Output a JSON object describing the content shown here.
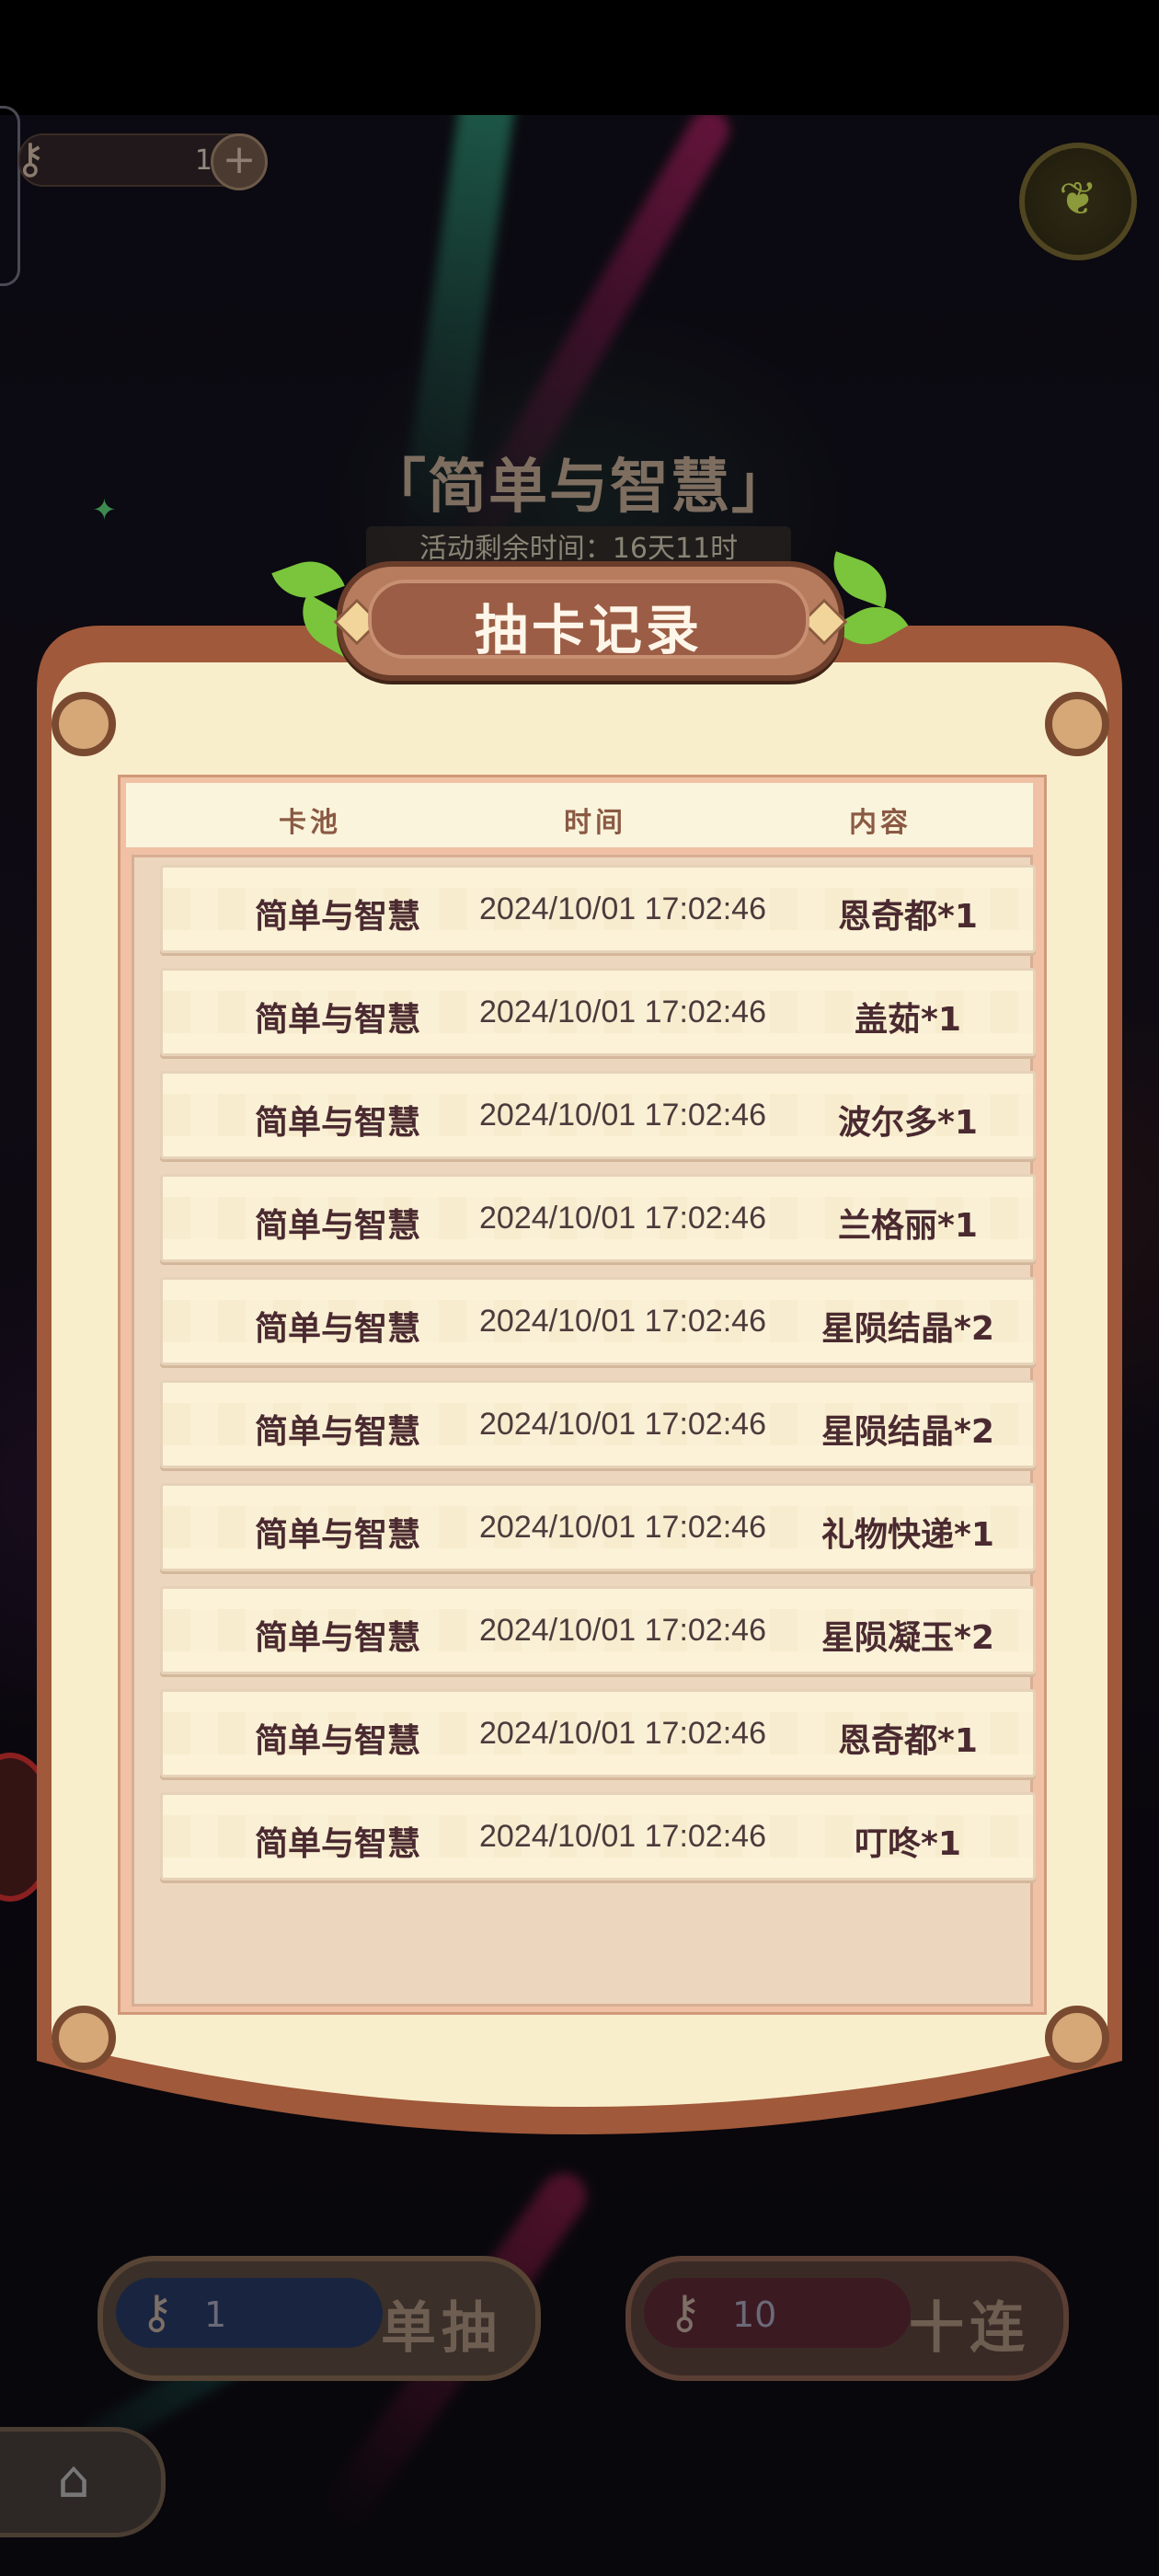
{
  "hud": {
    "key_count": "1",
    "plus": "+",
    "seed_icon": "seed-icon"
  },
  "event": {
    "title": "「简单与智慧」",
    "timer": "活动剩余时间：16天11时"
  },
  "modal": {
    "title": "抽卡记录",
    "headers": {
      "pool": "卡池",
      "time": "时间",
      "content": "内容"
    },
    "rows": [
      {
        "pool": "简单与智慧",
        "time": "2024/10/01 17:02:46",
        "content": "恩奇都*1"
      },
      {
        "pool": "简单与智慧",
        "time": "2024/10/01 17:02:46",
        "content": "盖茹*1"
      },
      {
        "pool": "简单与智慧",
        "time": "2024/10/01 17:02:46",
        "content": "波尔多*1"
      },
      {
        "pool": "简单与智慧",
        "time": "2024/10/01 17:02:46",
        "content": "兰格丽*1"
      },
      {
        "pool": "简单与智慧",
        "time": "2024/10/01 17:02:46",
        "content": "星陨结晶*2"
      },
      {
        "pool": "简单与智慧",
        "time": "2024/10/01 17:02:46",
        "content": "星陨结晶*2"
      },
      {
        "pool": "简单与智慧",
        "time": "2024/10/01 17:02:46",
        "content": "礼物快递*1"
      },
      {
        "pool": "简单与智慧",
        "time": "2024/10/01 17:02:46",
        "content": "星陨凝玉*2"
      },
      {
        "pool": "简单与智慧",
        "time": "2024/10/01 17:02:46",
        "content": "恩奇都*1"
      },
      {
        "pool": "简单与智慧",
        "time": "2024/10/01 17:02:46",
        "content": "叮咚*1"
      }
    ]
  },
  "controls": {
    "single": {
      "amount": "1",
      "label": "单抽"
    },
    "ten": {
      "amount": "10",
      "label": "十连"
    },
    "home_icon": "home-icon"
  },
  "colors": {
    "banner": "#9b5d45",
    "parchment": "#f9eecc",
    "text": "#4a2a30",
    "header_text": "#8a5a44"
  }
}
